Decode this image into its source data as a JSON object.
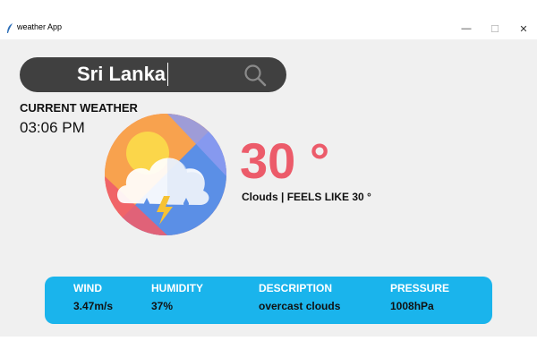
{
  "window": {
    "title": "weather App",
    "controls": {
      "minimize": "—",
      "maximize": "☐",
      "close": "✕"
    }
  },
  "search": {
    "value": "Sri Lanka",
    "icon": "search-icon"
  },
  "current": {
    "label": "CURRENT WEATHER",
    "time": "03:06 PM",
    "icon": "cloud-rain-lightning-icon",
    "temperature": "30 °",
    "condition": "Clouds | FEELS LIKE 30 °"
  },
  "stats": {
    "wind": {
      "label": "WIND",
      "value": "3.47m/s"
    },
    "humidity": {
      "label": "HUMIDITY",
      "value": "37%"
    },
    "description": {
      "label": "DESCRIPTION",
      "value": "overcast clouds"
    },
    "pressure": {
      "label": "PRESSURE",
      "value": "1008hPa"
    }
  },
  "colors": {
    "temperature": "#ec5b6a",
    "panel": "#1ab4ec",
    "search_bg": "#404040"
  }
}
